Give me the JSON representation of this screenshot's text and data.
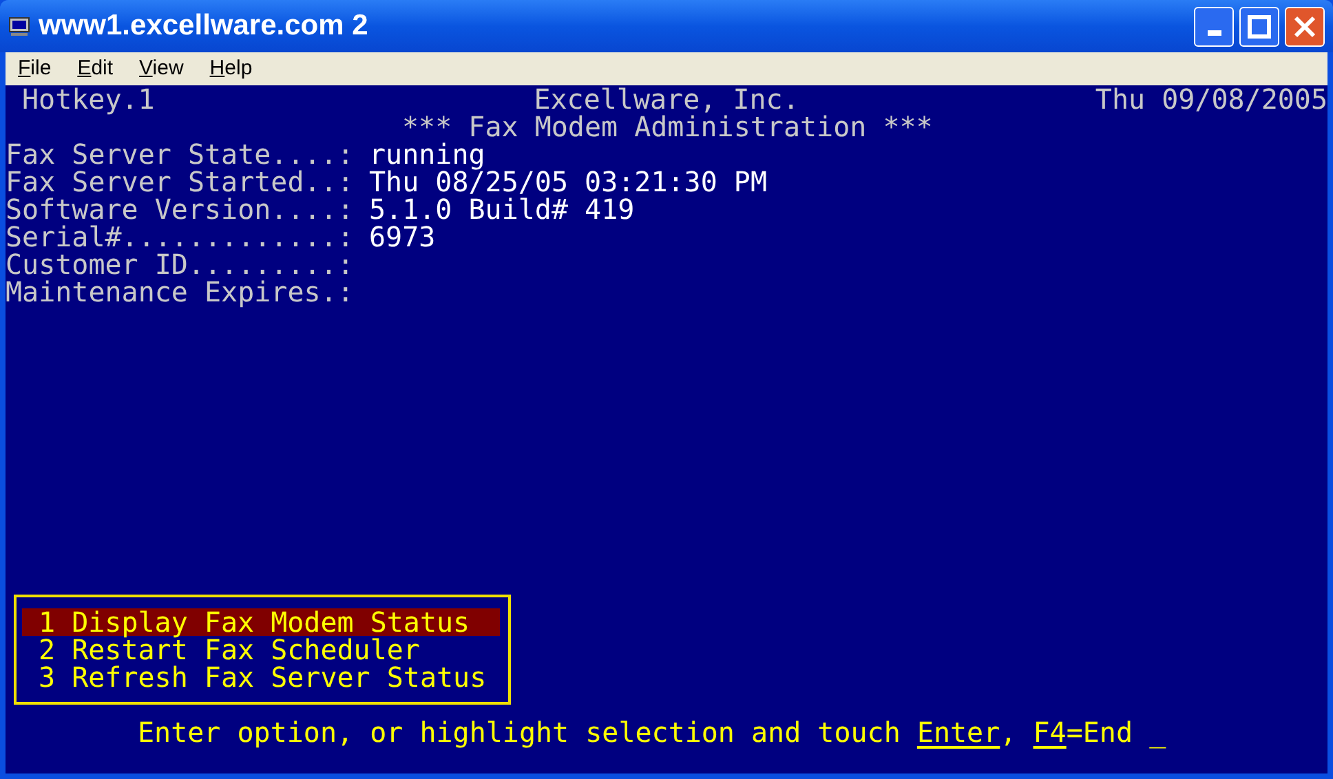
{
  "window": {
    "title": "www1.excellware.com 2"
  },
  "menu_bar": [
    "File",
    "Edit",
    "View",
    "Help"
  ],
  "terminal": {
    "header": {
      "left": "Hotkey.1",
      "center": "Excellware, Inc.",
      "right": "Thu 09/08/2005"
    },
    "title": "*** Fax Modem Administration ***",
    "fields": [
      {
        "label": "Fax Server State....:",
        "value": "running"
      },
      {
        "label": "Fax Server Started..:",
        "value": "Thu 08/25/05 03:21:30 PM"
      },
      {
        "label": "Software Version....:",
        "value": "5.1.0 Build# 419"
      },
      {
        "label": "Serial#.............:",
        "value": "6973"
      },
      {
        "label": "Customer ID.........:"
      },
      {
        "label": "Maintenance Expires.:"
      }
    ],
    "options": [
      {
        "label": "1 Display Fax Modem Status",
        "selected": true
      },
      {
        "label": "2 Restart Fax Scheduler",
        "selected": false
      },
      {
        "label": "3 Refresh Fax Server Status",
        "selected": false
      }
    ],
    "prompt": [
      {
        "kind": "plain",
        "text": "Enter option, or highlight selection and touch "
      },
      {
        "kind": "key",
        "text": "Enter"
      },
      {
        "kind": "plain",
        "text": ", "
      },
      {
        "kind": "key",
        "text": "F4"
      },
      {
        "kind": "plain",
        "text": "=End "
      }
    ],
    "cursor": "_"
  }
}
